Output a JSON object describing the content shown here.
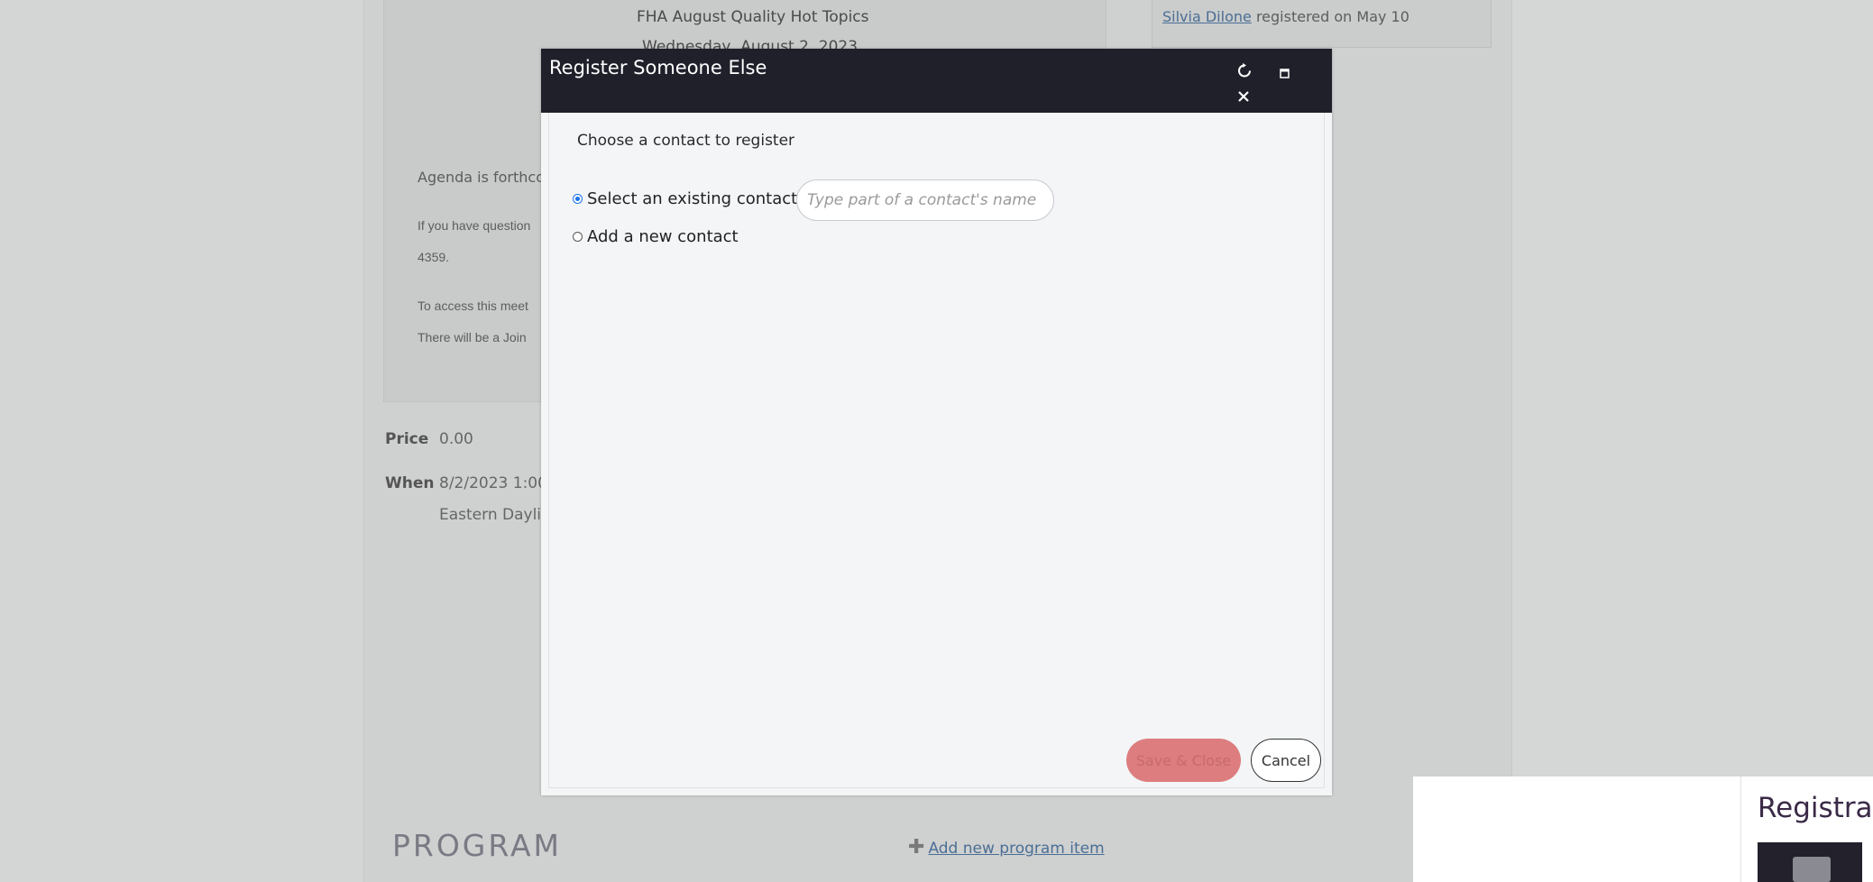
{
  "background": {
    "event_title": "FHA August Quality Hot Topics",
    "event_date_partial": "Wednesday, August 2, 2023",
    "agenda_text": "Agenda is forthco",
    "questions_text": "If you have question",
    "questions_text_2": "4359.",
    "access_text": "To access this meet",
    "join_text": "There will be a Join",
    "price_label": "Price",
    "price_value": "0.00",
    "when_label": "When",
    "when_value": "8/2/2023 1:00",
    "when_tz": "Eastern Dayligh",
    "side_registration": {
      "name": "Silvia Dilone",
      "text": "registered on May 10"
    },
    "program_heading": "PROGRAM",
    "add_program_label": "Add new program item",
    "registration_panel_title": "Registran"
  },
  "modal": {
    "title": "Register Someone Else",
    "subtitle": "Choose a contact to register",
    "options": [
      {
        "label": "Select an existing contact",
        "checked": true
      },
      {
        "label": "Add a new contact",
        "checked": false
      }
    ],
    "contact_search": {
      "value": "",
      "placeholder": "Type part of a contact's name"
    },
    "save_label": "Save & Close",
    "cancel_label": "Cancel",
    "header_icons": [
      "refresh-icon",
      "maximize-icon",
      "close-icon"
    ]
  },
  "colors": {
    "modal_header": "#20202b",
    "save_button": "#dd7d7f",
    "link": "#4a6f95",
    "overlay": "#d5d6d6"
  }
}
